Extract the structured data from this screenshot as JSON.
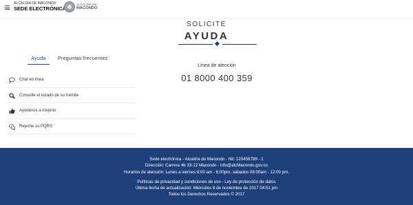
{
  "header": {
    "menu_icon": "hamburger-icon",
    "brand_small": "ALCALDÍA DE MACONDO",
    "brand_big": "SEDE ELECTRÓNICA",
    "logo_line1": "ALCALDÍA DE",
    "logo_line2": "MACONDO"
  },
  "hero": {
    "subtitle": "SOLICITE",
    "title": "AYUDA"
  },
  "tabs": [
    {
      "label": "Ayuda",
      "active": true
    },
    {
      "label": "Preguntas frecuentes",
      "active": false
    }
  ],
  "help_items": [
    {
      "label": "Chat en línea",
      "icon": "chat-bubble-icon"
    },
    {
      "label": "Consulte el estado de su trámite",
      "icon": "search-icon"
    },
    {
      "label": "Ayúdenos a mejorar",
      "icon": "thumbs-up-icon"
    },
    {
      "label": "Reporte su PQRS",
      "icon": "speech-bubbles-icon"
    }
  ],
  "contact": {
    "label": "Línea de atención",
    "phone": "01 8000 400 359"
  },
  "footer": {
    "line1": "Sede electrónica - Alcaldía de Macondo - Nit: 123456789 - 1",
    "line2": "Dirección: Carrera 4b 33-12 Macondo - info@alcMacondo.gov.co",
    "line3": "Horarios de atención: Lunes a viernes 8:00 am - 6:00pm, sábados 08:00am - 12:00 pm.",
    "line4": "Políticas de privacidad y condiciones de uso - Ley de protección de datos",
    "line5": "Última fecha de actualización: Miércoles 8 de noviembre de 2017 04:51 pm",
    "line6": "Todos los Derechos Reservados © 2017"
  },
  "colors": {
    "brand_blue": "#1f3f7a",
    "text": "#333333",
    "divider": "#ececec"
  }
}
